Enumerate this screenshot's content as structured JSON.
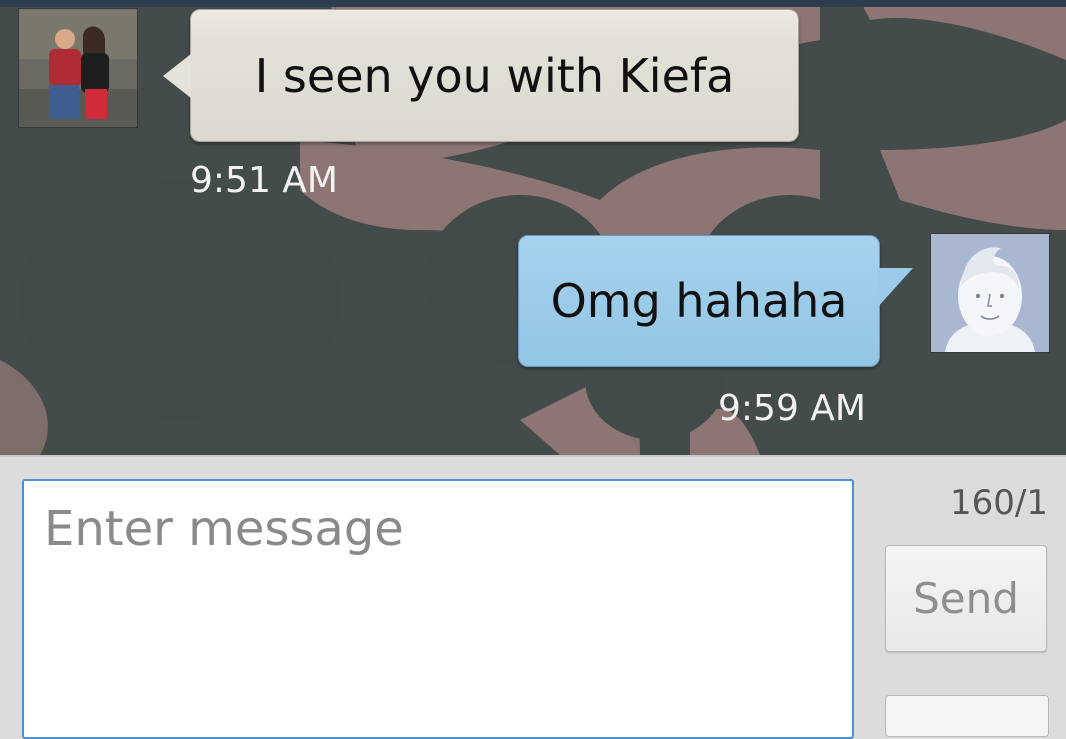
{
  "messages": [
    {
      "direction": "incoming",
      "text": "I seen you with Kiefa",
      "time": "9:51 AM",
      "avatar": "contact-photo"
    },
    {
      "direction": "outgoing",
      "text": "Omg hahaha",
      "time": "9:59 AM",
      "avatar": "default-person-icon"
    }
  ],
  "compose": {
    "placeholder": "Enter message",
    "counter": "160/1",
    "send_label": "Send"
  },
  "colors": {
    "incoming_bubble": "#e2e0d7",
    "outgoing_bubble": "#93c5e5",
    "input_border": "#4a90d9",
    "background_pattern_dark": "#434a4a",
    "background_pattern_light": "#8c7573"
  }
}
